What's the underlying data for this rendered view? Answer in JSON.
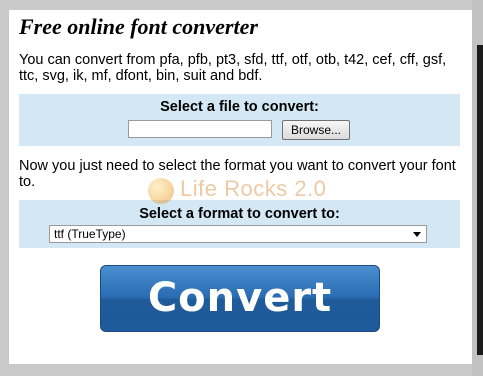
{
  "title": "Free online font converter",
  "intro": "You can convert from pfa, pfb, pt3, sfd, ttf, otf, otb, t42, cef, cff, gsf, ttc, svg, ik, mf, dfont, bin, suit and bdf.",
  "file_section": {
    "heading": "Select a file to convert:",
    "file_value": "",
    "browse_label": "Browse..."
  },
  "instruction": "Now you just need to select the format you want to convert your font to.",
  "watermark": "Life Rocks 2.0",
  "format_section": {
    "heading": "Select a format to convert to:",
    "selected": "ttf (TrueType)"
  },
  "convert_label": "Convert",
  "colors": {
    "section_bg": "#d3e7f4",
    "convert_button": "#2a6cb2"
  }
}
